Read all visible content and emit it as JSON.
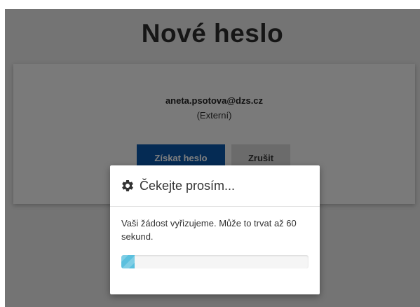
{
  "page": {
    "title": "Nové heslo"
  },
  "account": {
    "email": "aneta.psotova@dzs.cz",
    "type": "(Externí)"
  },
  "actions": {
    "primary_label": "Získat heslo",
    "secondary_label": "Zrušit"
  },
  "modal": {
    "icon": "gear-icon",
    "title": "Čekejte prosím...",
    "message": "Vaši žádost vyřizujeme. Může to trvat až 60 sekund.",
    "progress_percent": 7
  },
  "colors": {
    "primary_button": "#0a56a8",
    "secondary_button": "#d6d6d6",
    "progress_fill": "#5bc0de"
  }
}
